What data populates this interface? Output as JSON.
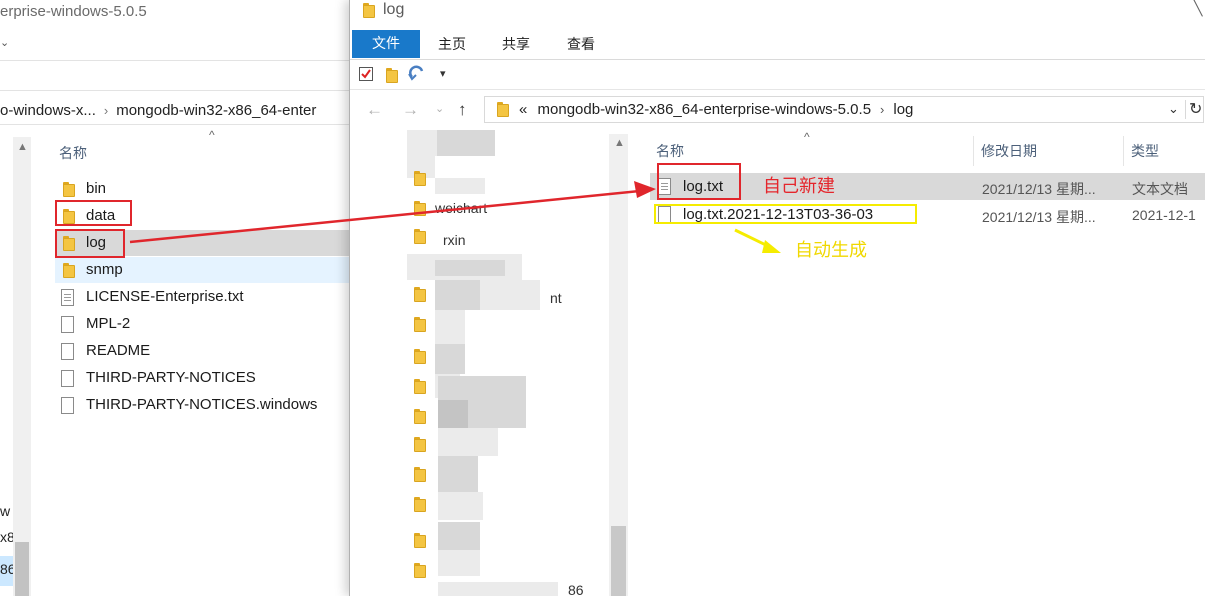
{
  "back_window": {
    "title_fragment": "erprise-windows-5.0.5",
    "address_parts": [
      "o-windows-x...",
      "mongodb-win32-x86_64-enter"
    ],
    "column_name": "名称",
    "left_fragments": [
      "w",
      "x8",
      "86"
    ],
    "items": [
      {
        "name": "bin",
        "icon": "folder-icon"
      },
      {
        "name": "data",
        "icon": "folder-icon"
      },
      {
        "name": "log",
        "icon": "folder-icon"
      },
      {
        "name": "snmp",
        "icon": "folder-icon"
      },
      {
        "name": "LICENSE-Enterprise.txt",
        "icon": "text-file-icon"
      },
      {
        "name": "MPL-2",
        "icon": "file-icon"
      },
      {
        "name": "README",
        "icon": "file-icon"
      },
      {
        "name": "THIRD-PARTY-NOTICES",
        "icon": "file-icon"
      },
      {
        "name": "THIRD-PARTY-NOTICES.windows",
        "icon": "file-icon"
      }
    ]
  },
  "front_window": {
    "title": "log",
    "ribbon_tabs": [
      "文件",
      "主页",
      "共享",
      "查看"
    ],
    "address_prefix": "«",
    "address_parts": [
      "mongodb-win32-x86_64-enterprise-windows-5.0.5",
      "log"
    ],
    "columns": {
      "name": "名称",
      "modified": "修改日期",
      "type": "类型"
    },
    "nav_fragments": [
      "weichart",
      "rxin",
      "nt",
      "86"
    ],
    "files": [
      {
        "name": "log.txt",
        "modified": "2021/12/13 星期...",
        "type": "文本文档",
        "icon": "text-file-icon"
      },
      {
        "name": "log.txt.2021-12-13T03-36-03",
        "modified": "2021/12/13 星期...",
        "type": "2021-12-1",
        "icon": "file-icon"
      }
    ]
  },
  "annotations": {
    "created_manually": "自己新建",
    "auto_generated": "自动生成",
    "red_color": "#e0262c",
    "yellow_color": "#f5ec00"
  }
}
